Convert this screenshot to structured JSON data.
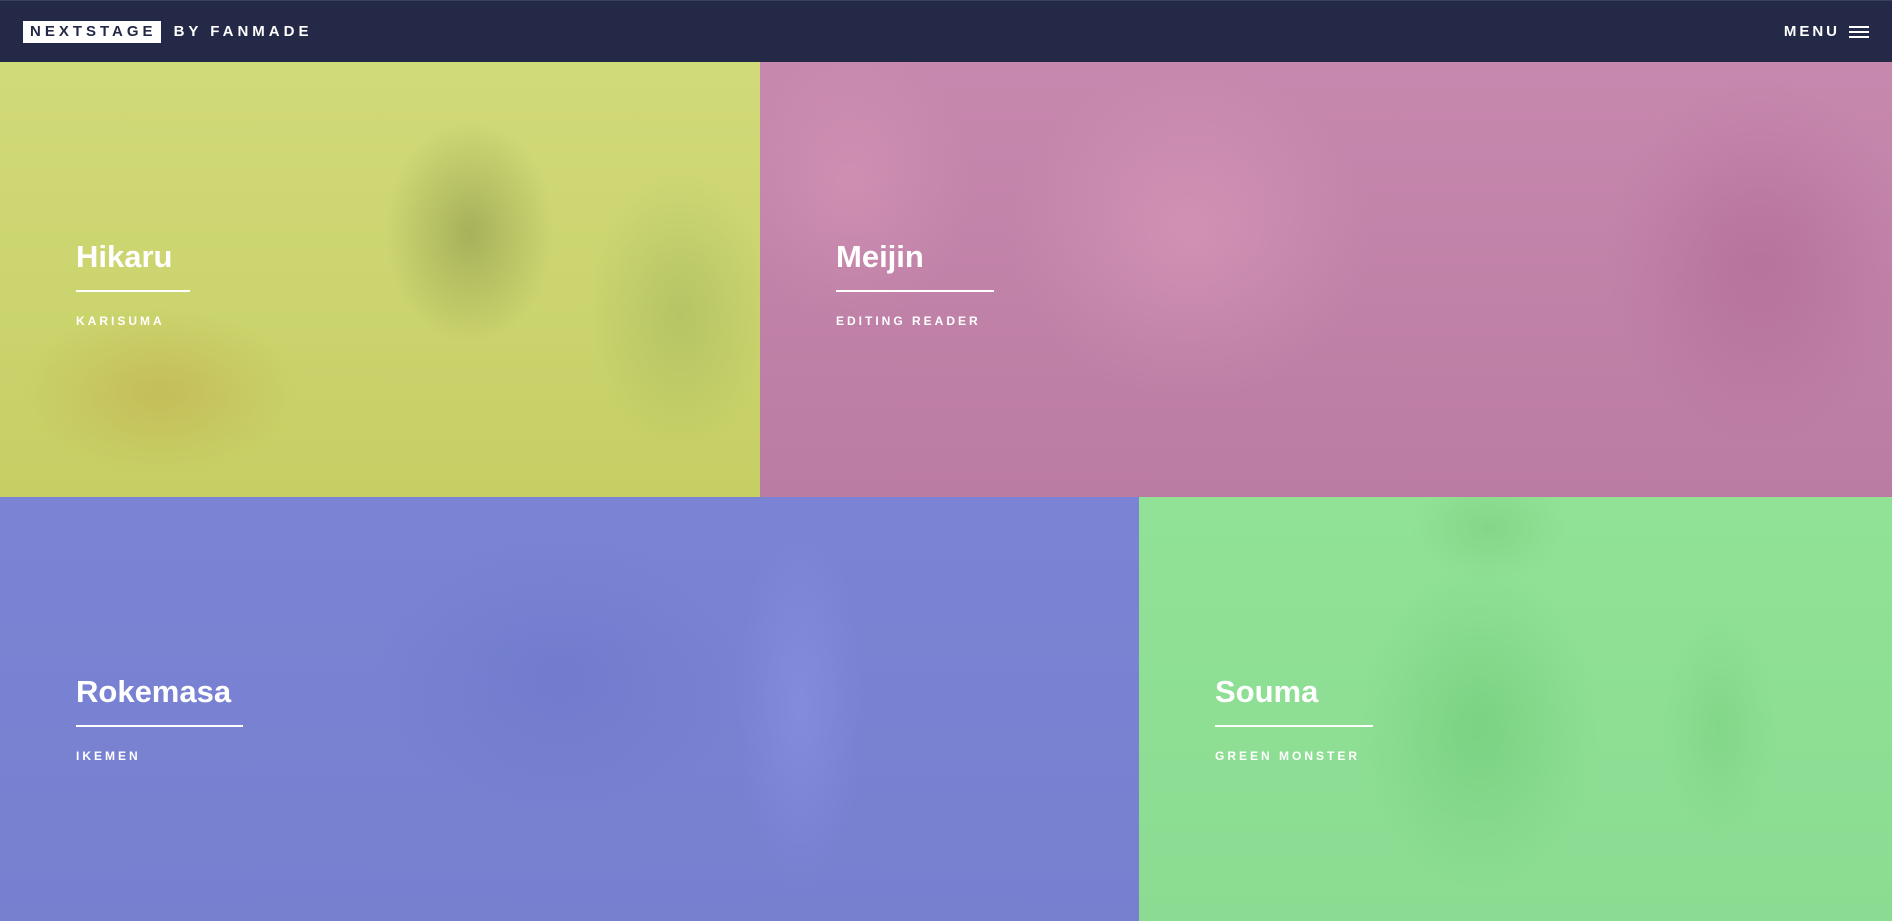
{
  "header": {
    "brand_name": "NEXTSTAGE",
    "brand_suffix": "BY FANMADE",
    "menu_label": "MENU",
    "background": "#232946"
  },
  "tiles": [
    {
      "name": "Hikaru",
      "role": "KARISUMA",
      "color": "#cbd56a"
    },
    {
      "name": "Meijin",
      "role": "EDITING READER",
      "color": "#c083a8"
    },
    {
      "name": "Rokemasa",
      "role": "IKEMEN",
      "color": "#7a83d2"
    },
    {
      "name": "Souma",
      "role": "GREEN MONSTER",
      "color": "#8fe095"
    }
  ],
  "icons": {
    "menu": "hamburger-icon"
  }
}
